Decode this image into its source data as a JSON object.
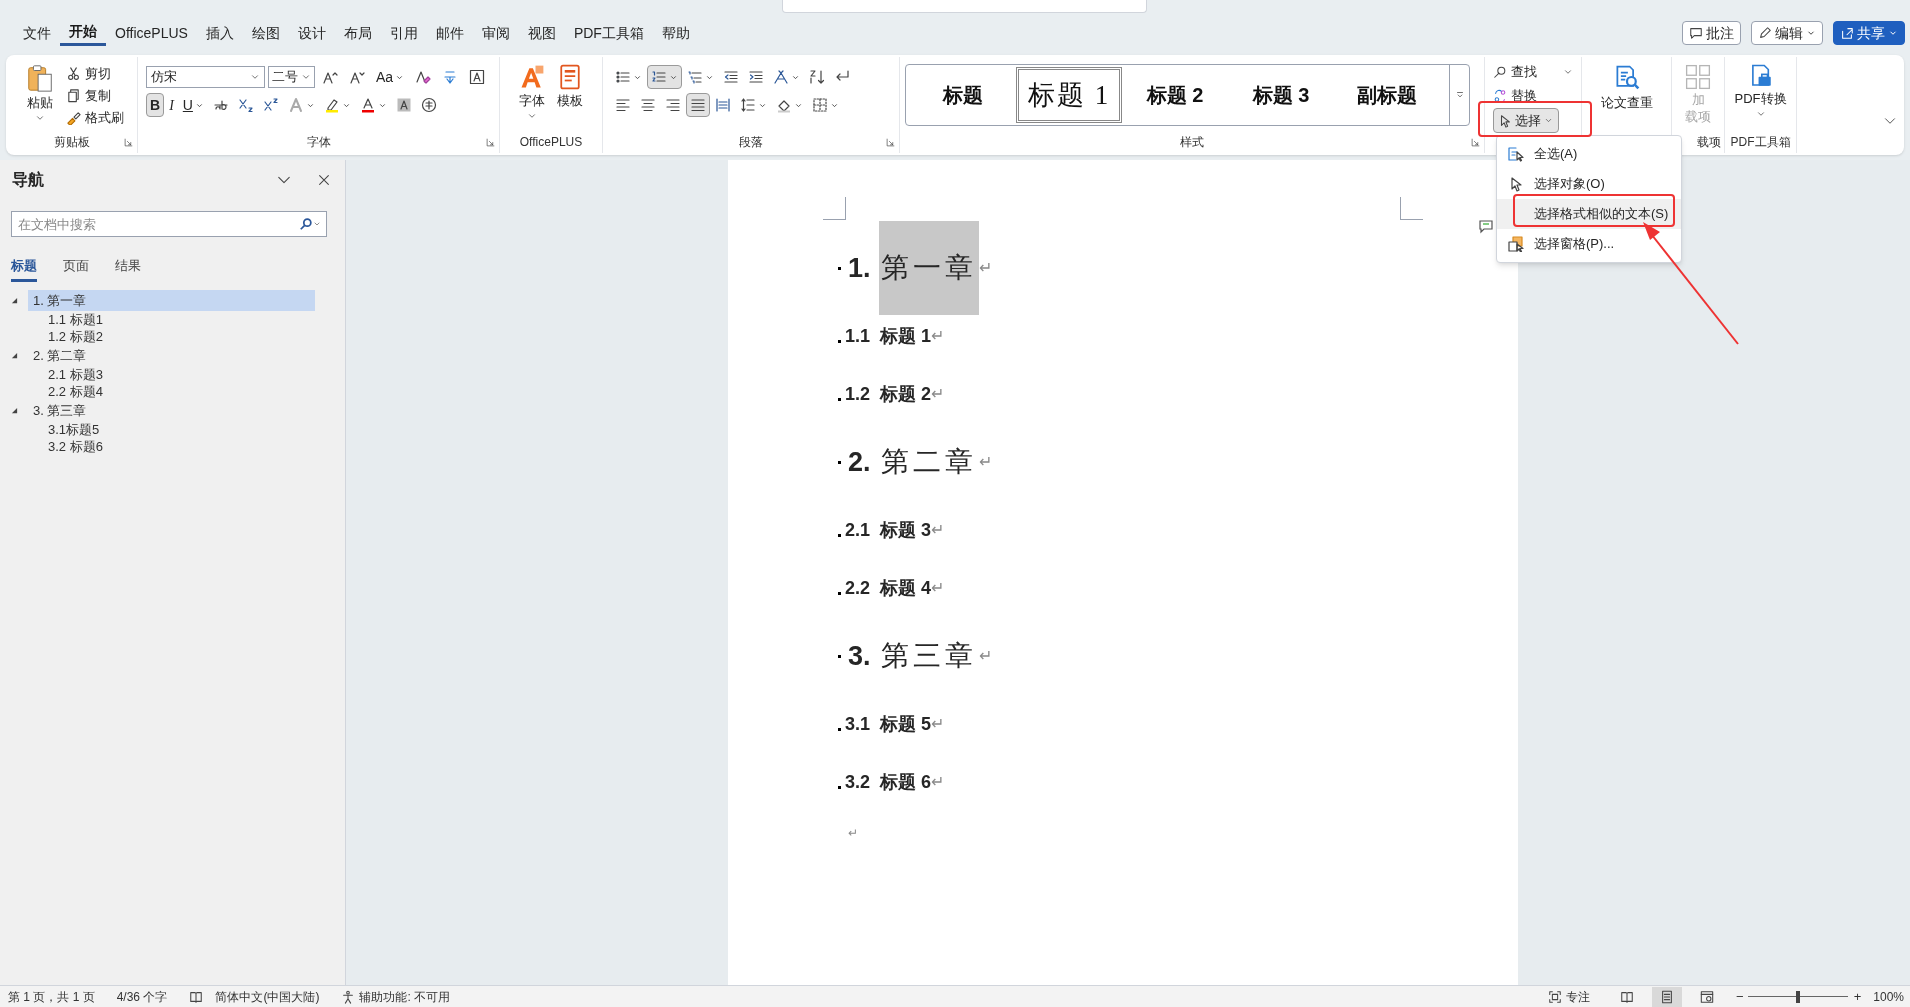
{
  "menu_tabs": [
    {
      "label": "文件",
      "selected": false
    },
    {
      "label": "开始",
      "selected": true
    },
    {
      "label": "OfficePLUS",
      "selected": false
    },
    {
      "label": "插入",
      "selected": false
    },
    {
      "label": "绘图",
      "selected": false
    },
    {
      "label": "设计",
      "selected": false
    },
    {
      "label": "布局",
      "selected": false
    },
    {
      "label": "引用",
      "selected": false
    },
    {
      "label": "邮件",
      "selected": false
    },
    {
      "label": "审阅",
      "selected": false
    },
    {
      "label": "视图",
      "selected": false
    },
    {
      "label": "PDF工具箱",
      "selected": false
    },
    {
      "label": "帮助",
      "selected": false
    }
  ],
  "header_buttons": [
    {
      "kind": "comment",
      "label": "批注"
    },
    {
      "kind": "edit",
      "label": "编辑"
    },
    {
      "kind": "share",
      "label": "共享"
    }
  ],
  "clipboard": {
    "paste": "粘贴",
    "cut": "剪切",
    "copy": "复制",
    "format_painter": "格式刷",
    "group_label": "剪贴板"
  },
  "font": {
    "font_name": "仿宋",
    "font_size": "二号",
    "group_label": "字体",
    "row1": [
      {
        "kind": "grow",
        "pressed": false
      },
      {
        "kind": "shrink",
        "pressed": false
      },
      {
        "kind": "case",
        "label": "Aa",
        "dropdown": true,
        "pressed": false
      },
      {
        "kind": "clear",
        "pressed": false
      },
      {
        "kind": "phonetic",
        "pressed": false
      },
      {
        "kind": "charborder",
        "pressed": false
      }
    ],
    "row2": [
      {
        "kind": "bold",
        "label": "B",
        "pressed": true
      },
      {
        "kind": "italic",
        "label": "I",
        "pressed": false
      },
      {
        "kind": "underline",
        "label": "U",
        "dropdown": true,
        "pressed": false
      },
      {
        "kind": "strike",
        "pressed": false
      },
      {
        "kind": "sub",
        "pressed": false
      },
      {
        "kind": "sup",
        "pressed": false
      },
      {
        "kind": "effect",
        "dropdown": true,
        "pressed": false
      },
      {
        "kind": "highlight",
        "dropdown": true,
        "pressed": false
      },
      {
        "kind": "fontcolor",
        "dropdown": true,
        "pressed": false
      },
      {
        "kind": "shading",
        "pressed": false
      },
      {
        "kind": "enclose",
        "pressed": false
      }
    ]
  },
  "officeplus": {
    "group_label": "OfficePLUS",
    "buttons": [
      {
        "kind": "font-art",
        "label": "字体",
        "dropdown": true
      },
      {
        "kind": "template",
        "label": "模板"
      }
    ]
  },
  "paragraph": {
    "group_label": "段落",
    "row1": [
      {
        "kind": "bullets",
        "dropdown": true,
        "pressed": false
      },
      {
        "kind": "numbering",
        "dropdown": true,
        "pressed": true
      },
      {
        "kind": "multilevel",
        "dropdown": true,
        "pressed": false
      },
      {
        "kind": "outdent",
        "pressed": false
      },
      {
        "kind": "indent",
        "pressed": false
      },
      {
        "kind": "asian",
        "dropdown": true,
        "pressed": false
      },
      {
        "kind": "sort",
        "pressed": false
      },
      {
        "kind": "marks",
        "pressed": false
      }
    ],
    "row2": [
      {
        "kind": "left",
        "pressed": false
      },
      {
        "kind": "center",
        "pressed": false
      },
      {
        "kind": "right",
        "pressed": false
      },
      {
        "kind": "justify",
        "pressed": true
      },
      {
        "kind": "distribute",
        "pressed": false
      },
      {
        "kind": "spacing",
        "dropdown": true,
        "pressed": false
      },
      {
        "kind": "fill",
        "dropdown": true,
        "pressed": false
      },
      {
        "kind": "borders",
        "dropdown": true,
        "pressed": false
      }
    ]
  },
  "styles": {
    "group_label": "样式",
    "items": [
      {
        "label": "标题",
        "selected": false
      },
      {
        "label": "标题 1",
        "selected": true
      },
      {
        "label": "标题 2",
        "selected": false
      },
      {
        "label": "标题 3",
        "selected": false
      },
      {
        "label": "副标题",
        "selected": false
      }
    ]
  },
  "editing": {
    "find": "查找",
    "replace": "替换",
    "select": {
      "label": "选择",
      "expanded": true
    }
  },
  "thesis_check": "论文查重",
  "addins": {
    "label_line1": "加",
    "label_line2": "载项",
    "disabled": true,
    "group_label": "载项"
  },
  "pdf": {
    "label": "PDF转换",
    "group_label": "PDF工具箱"
  },
  "select_menu": [
    {
      "kind": "select-all",
      "label": "全选(A)",
      "selected": false
    },
    {
      "kind": "select-objects",
      "label": "选择对象(O)",
      "selected": false
    },
    {
      "kind": "similar",
      "label": "选择格式相似的文本(S)",
      "selected": true
    },
    {
      "kind": "pane",
      "label": "选择窗格(P)...",
      "selected": false
    }
  ],
  "navigation": {
    "title": "导航",
    "search": {
      "placeholder": "在文档中搜索"
    },
    "tabs": [
      {
        "label": "标题",
        "selected": true
      },
      {
        "label": "页面",
        "selected": false
      },
      {
        "label": "结果",
        "selected": false
      }
    ],
    "tree": [
      {
        "label": "1. 第一章",
        "selected": true,
        "expanded": true,
        "children": [
          {
            "label": "1.1 标题1",
            "selected": false
          },
          {
            "label": "1.2 标题2",
            "selected": false
          }
        ]
      },
      {
        "label": "2. 第二章",
        "selected": false,
        "expanded": true,
        "children": [
          {
            "label": "2.1 标题3",
            "selected": false
          },
          {
            "label": "2.2 标题4",
            "selected": false
          }
        ]
      },
      {
        "label": "3. 第三章",
        "selected": false,
        "expanded": true,
        "children": [
          {
            "label": "3.1标题5",
            "selected": false
          },
          {
            "label": "3.2 标题6",
            "selected": false
          }
        ]
      }
    ]
  },
  "document": {
    "paragraphs": [
      {
        "kind": "chapter",
        "number": "1.",
        "text": "第一章",
        "mark": "↵",
        "selected": true
      },
      {
        "kind": "section",
        "number": "1.1",
        "text": "标题 1",
        "mark": "↵"
      },
      {
        "kind": "section",
        "number": "1.2",
        "text": "标题 2",
        "mark": "↵"
      },
      {
        "kind": "chapter",
        "number": "2.",
        "text": "第二章",
        "mark": "↵",
        "selected": false
      },
      {
        "kind": "section",
        "number": "2.1",
        "text": "标题 3",
        "mark": "↵"
      },
      {
        "kind": "section",
        "number": "2.2",
        "text": "标题 4",
        "mark": "↵"
      },
      {
        "kind": "chapter",
        "number": "3.",
        "text": "第三章",
        "mark": "↵",
        "selected": false
      },
      {
        "kind": "section",
        "number": "3.1",
        "text": "标题 5",
        "mark": "↵"
      },
      {
        "kind": "section",
        "number": "3.2",
        "text": "标题 6",
        "mark": "↵"
      },
      {
        "kind": "empty",
        "mark": "↵"
      }
    ]
  },
  "status_bar": {
    "page": "第 1 页，共 1 页",
    "words": "4/36 个字",
    "language": "简体中文(中国大陆)",
    "accessibility": "辅助功能: 不可用",
    "focus": "专注",
    "views": [
      {
        "kind": "read",
        "selected": false
      },
      {
        "kind": "print",
        "selected": true
      },
      {
        "kind": "web",
        "selected": false
      }
    ],
    "zoom_out": "−",
    "zoom_in": "+",
    "zoom": {
      "level": 0.5
    },
    "zoom_percent": "100%"
  }
}
